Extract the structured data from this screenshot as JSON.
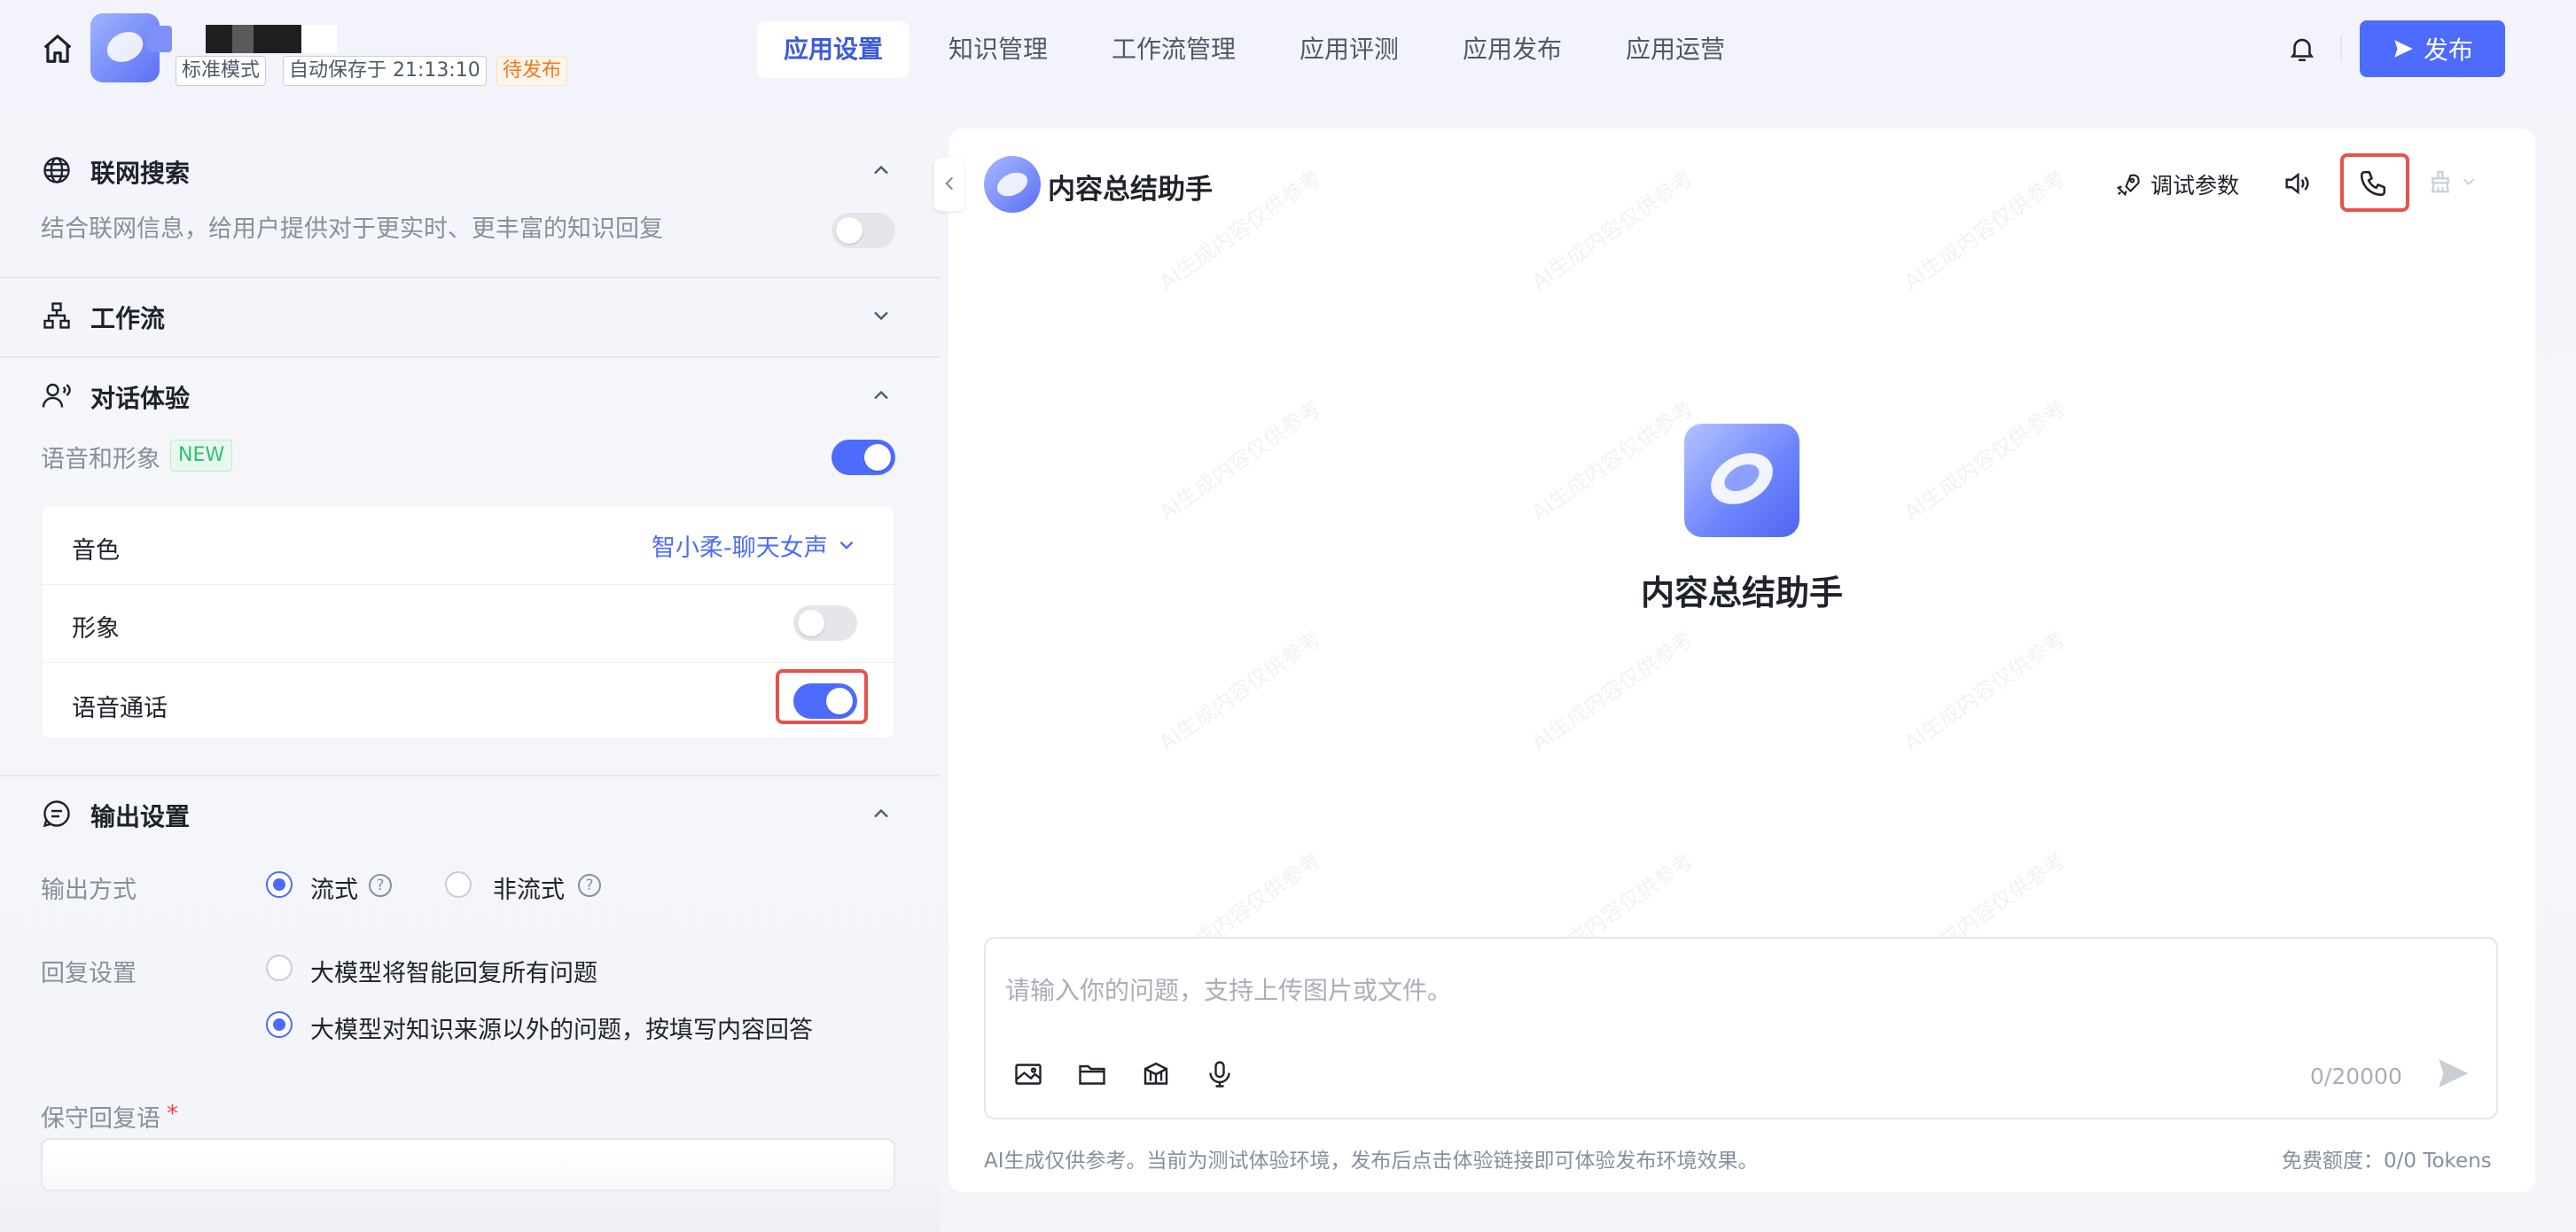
{
  "header": {
    "app_name": "",
    "mode_tag": "标准模式",
    "autosave": "自动保存于 21:13:10",
    "status_tag": "待发布",
    "tabs": [
      {
        "label": "应用设置",
        "active": true
      },
      {
        "label": "知识管理",
        "active": false
      },
      {
        "label": "工作流管理",
        "active": false
      },
      {
        "label": "应用评测",
        "active": false
      },
      {
        "label": "应用发布",
        "active": false
      },
      {
        "label": "应用运营",
        "active": false
      }
    ],
    "publish_label": "发布"
  },
  "left": {
    "web_search": {
      "title": "联网搜索",
      "desc": "结合联网信息，给用户提供对于更实时、更丰富的知识回复",
      "enabled": false
    },
    "workflow": {
      "title": "工作流"
    },
    "dialog": {
      "title": "对话体验",
      "voice_avatar_label": "语音和形象",
      "new_badge": "NEW",
      "voice_avatar_enabled": true,
      "voice_label": "音色",
      "voice_value": "智小柔-聊天女声",
      "avatar_label": "形象",
      "avatar_enabled": false,
      "voice_call_label": "语音通话",
      "voice_call_enabled": true
    },
    "output": {
      "title": "输出设置",
      "mode_label": "输出方式",
      "mode_options": [
        "流式",
        "非流式"
      ],
      "mode_selected": "流式",
      "reply_label": "回复设置",
      "reply_options": [
        "大模型将智能回复所有问题",
        "大模型对知识来源以外的问题，按填写内容回答"
      ],
      "reply_selected": 1,
      "fallback_label": "保守回复语",
      "required_mark": "*"
    }
  },
  "preview": {
    "assistant_name": "内容总结助手",
    "debug_params": "调试参数",
    "center_name": "内容总结助手",
    "input_placeholder": "请输入你的问题，支持上传图片或文件。",
    "char_count": "0/20000",
    "disclaimer": "AI生成仅供参考。当前为测试体验环境，发布后点击体验链接即可体验发布环境效果。",
    "quota": "免费额度：0/0 Tokens",
    "watermark": "AI生成内容仅供参考"
  },
  "colors": {
    "accent": "#4d6bfe",
    "highlight": "#e5534b",
    "pending": "#f0781e"
  }
}
